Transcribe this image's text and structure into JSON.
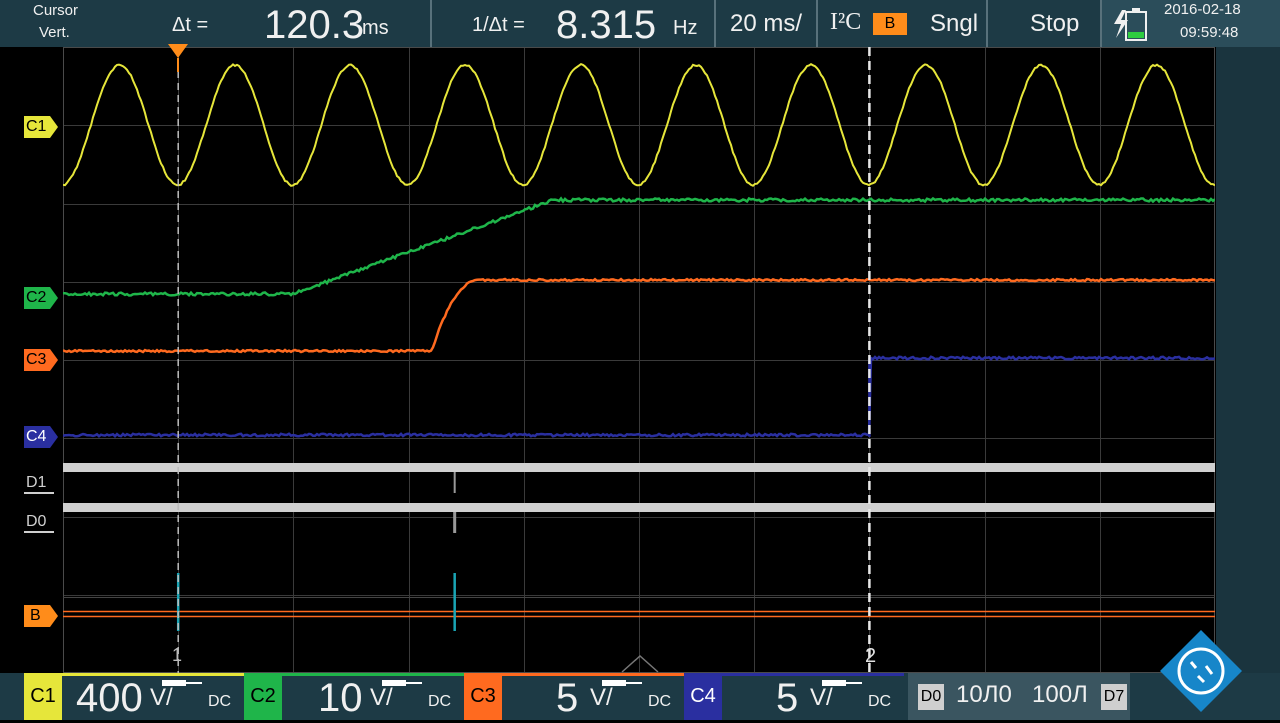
{
  "topbar": {
    "cursor_label": "Cursor",
    "cursor_mode": "Vert.",
    "delta_t_label": "Δt =",
    "delta_t_value": "120.3",
    "delta_t_unit": "ms",
    "inv_delta_label": "1/Δt =",
    "inv_delta_value": "8.315",
    "inv_delta_unit": "Hz",
    "timebase": "20 ms/",
    "protocol": "I²C",
    "bus": "B",
    "trigger_mode": "Sngl",
    "run_state": "Stop",
    "date": "2016-02-18",
    "time": "09:59:48"
  },
  "channels": {
    "c1": {
      "label": "C1",
      "scale": "400",
      "unit": "V/",
      "coupling": "DC",
      "color": "#e6e63a"
    },
    "c2": {
      "label": "C2",
      "scale": "10",
      "unit": "V/",
      "coupling": "DC",
      "color": "#1fb54a"
    },
    "c3": {
      "label": "C3",
      "scale": "5",
      "unit": "V/",
      "coupling": "DC",
      "color": "#ff6a1f"
    },
    "c4": {
      "label": "C4",
      "scale": "5",
      "unit": "V/",
      "coupling": "DC",
      "color": "#2a2fa0"
    }
  },
  "digital": {
    "d1_label": "D1",
    "d0_label": "D0",
    "range_start": "D0",
    "range_end": "D7",
    "threshold_a": "10Л0",
    "threshold_b": "100Л",
    "bus_label": "B"
  },
  "cursors": {
    "cursor1_label": "1",
    "cursor2_label": "2"
  },
  "waveforms": {
    "c1_periods": 10,
    "c2_ramp": [
      0.2,
      0.425
    ],
    "c3_step": [
      0.32,
      0.36
    ],
    "c4_step": 0.7,
    "cursor1": 0.1,
    "cursor2": 0.7,
    "spike_positions": [
      0.1,
      0.34
    ]
  }
}
